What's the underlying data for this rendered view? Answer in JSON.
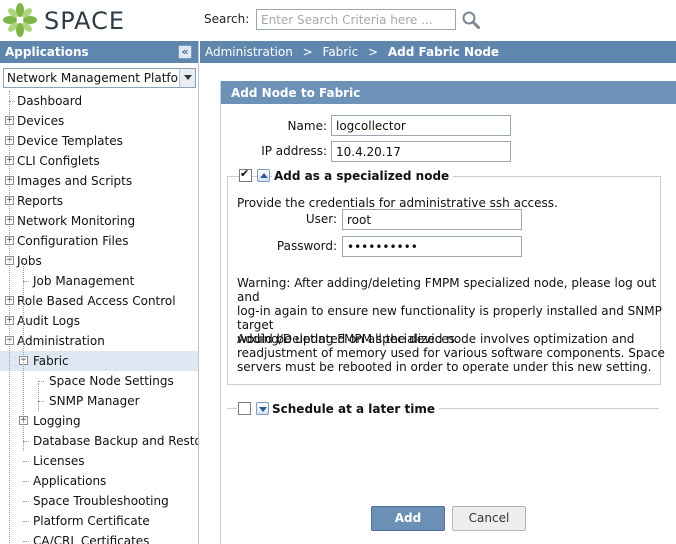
{
  "header": {
    "logo_text": "SPACE",
    "search_label": "Search:",
    "search_placeholder": "Enter Search Criteria here ..."
  },
  "left_panel": {
    "title": "Applications",
    "selected_app": "Network Management Platform",
    "tree": [
      {
        "label": "Dashboard",
        "level": 0,
        "toggle": ""
      },
      {
        "label": "Devices",
        "level": 0,
        "toggle": "+"
      },
      {
        "label": "Device Templates",
        "level": 0,
        "toggle": "+"
      },
      {
        "label": "CLI Configlets",
        "level": 0,
        "toggle": "+"
      },
      {
        "label": "Images and Scripts",
        "level": 0,
        "toggle": "+"
      },
      {
        "label": "Reports",
        "level": 0,
        "toggle": "+"
      },
      {
        "label": "Network Monitoring",
        "level": 0,
        "toggle": "+"
      },
      {
        "label": "Configuration Files",
        "level": 0,
        "toggle": "+"
      },
      {
        "label": "Jobs",
        "level": 0,
        "toggle": "-"
      },
      {
        "label": "Job Management",
        "level": 1,
        "toggle": ""
      },
      {
        "label": "Role Based Access Control",
        "level": 0,
        "toggle": "+"
      },
      {
        "label": "Audit Logs",
        "level": 0,
        "toggle": "+"
      },
      {
        "label": "Administration",
        "level": 0,
        "toggle": "-"
      },
      {
        "label": "Fabric",
        "level": 1,
        "toggle": "-",
        "selected": true
      },
      {
        "label": "Space Node Settings",
        "level": 2,
        "toggle": ""
      },
      {
        "label": "SNMP Manager",
        "level": 2,
        "toggle": ""
      },
      {
        "label": "Logging",
        "level": 1,
        "toggle": "+"
      },
      {
        "label": "Database Backup and Restore",
        "level": 1,
        "toggle": ""
      },
      {
        "label": "Licenses",
        "level": 1,
        "toggle": ""
      },
      {
        "label": "Applications",
        "level": 1,
        "toggle": ""
      },
      {
        "label": "Space Troubleshooting",
        "level": 1,
        "toggle": ""
      },
      {
        "label": "Platform Certificate",
        "level": 1,
        "toggle": ""
      },
      {
        "label": "CA/CRL Certificates",
        "level": 1,
        "toggle": ""
      }
    ]
  },
  "breadcrumb": {
    "items": [
      "Administration",
      "Fabric"
    ],
    "separator": ">",
    "current": "Add Fabric Node"
  },
  "form": {
    "title": "Add Node to Fabric",
    "name_label": "Name:",
    "name_value": "logcollector",
    "ip_label": "IP address:",
    "ip_value": "10.4.20.17",
    "specialized": {
      "label": "Add as a specialized node",
      "checked": true,
      "intro": "Provide the credentials for administrative ssh access.",
      "user_label": "User:",
      "user_value": "root",
      "password_label": "Password:",
      "password_value": "••••••••••",
      "warning": [
        "Warning: After adding/deleting FMPM specialized node, please log out and",
        "log-in again to ensure new functionality is properly installed and SNMP target",
        "would be updated on all the devices."
      ],
      "note": [
        "Adding/Deleting FMPM specialized node involves optimization and",
        "readjustment of memory used for various software components. Space",
        "servers must be rebooted in order to operate under this new setting."
      ]
    },
    "schedule": {
      "label": "Schedule at a later time",
      "checked": false
    },
    "add_label": "Add",
    "cancel_label": "Cancel"
  },
  "colors": {
    "header_bar": "#5f86ad",
    "form_header": "#6d92b8",
    "selected_row": "#dde8f3"
  }
}
